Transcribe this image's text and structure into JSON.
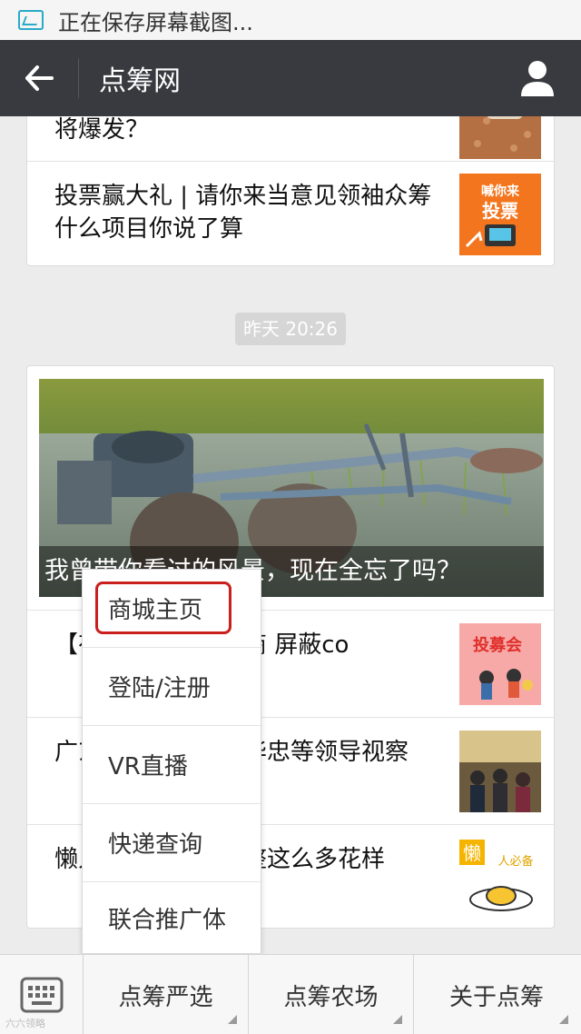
{
  "status": {
    "text": "正在保存屏幕截图..."
  },
  "header": {
    "title": "点筹网"
  },
  "feed": {
    "top_card": {
      "items": [
        {
          "title": "将爆发？"
        },
        {
          "title": "投票赢大礼 | 请你来当意见领袖众筹什么项目你说了算",
          "thumb_line1": "喊你来",
          "thumb_line2": "投票"
        }
      ]
    },
    "timestamp": "昨天 20:26",
    "main_card": {
      "cover_caption": "我曾带你看过的风景，现在全忘了吗？",
      "items": [
        {
          "title": "【有】朋友中有微商 屏蔽co",
          "thumb_text": "投募会"
        },
        {
          "title": "广东省委副书记陆华忠等领导视察"
        },
        {
          "title": "懒人必备，吃个还整这么多花样",
          "thumb_text": "懒",
          "thumb_text2": "人必备"
        }
      ]
    }
  },
  "popup": {
    "items": [
      "商城主页",
      "登陆/注册",
      "VR直播",
      "快递查询",
      "联合推广体"
    ],
    "highlighted_index": 0,
    "highlight_color": "#c9201e"
  },
  "bottom_menu": {
    "tabs": [
      "点筹严选",
      "点筹农场",
      "关于点筹"
    ],
    "watermark": "六六领略"
  }
}
